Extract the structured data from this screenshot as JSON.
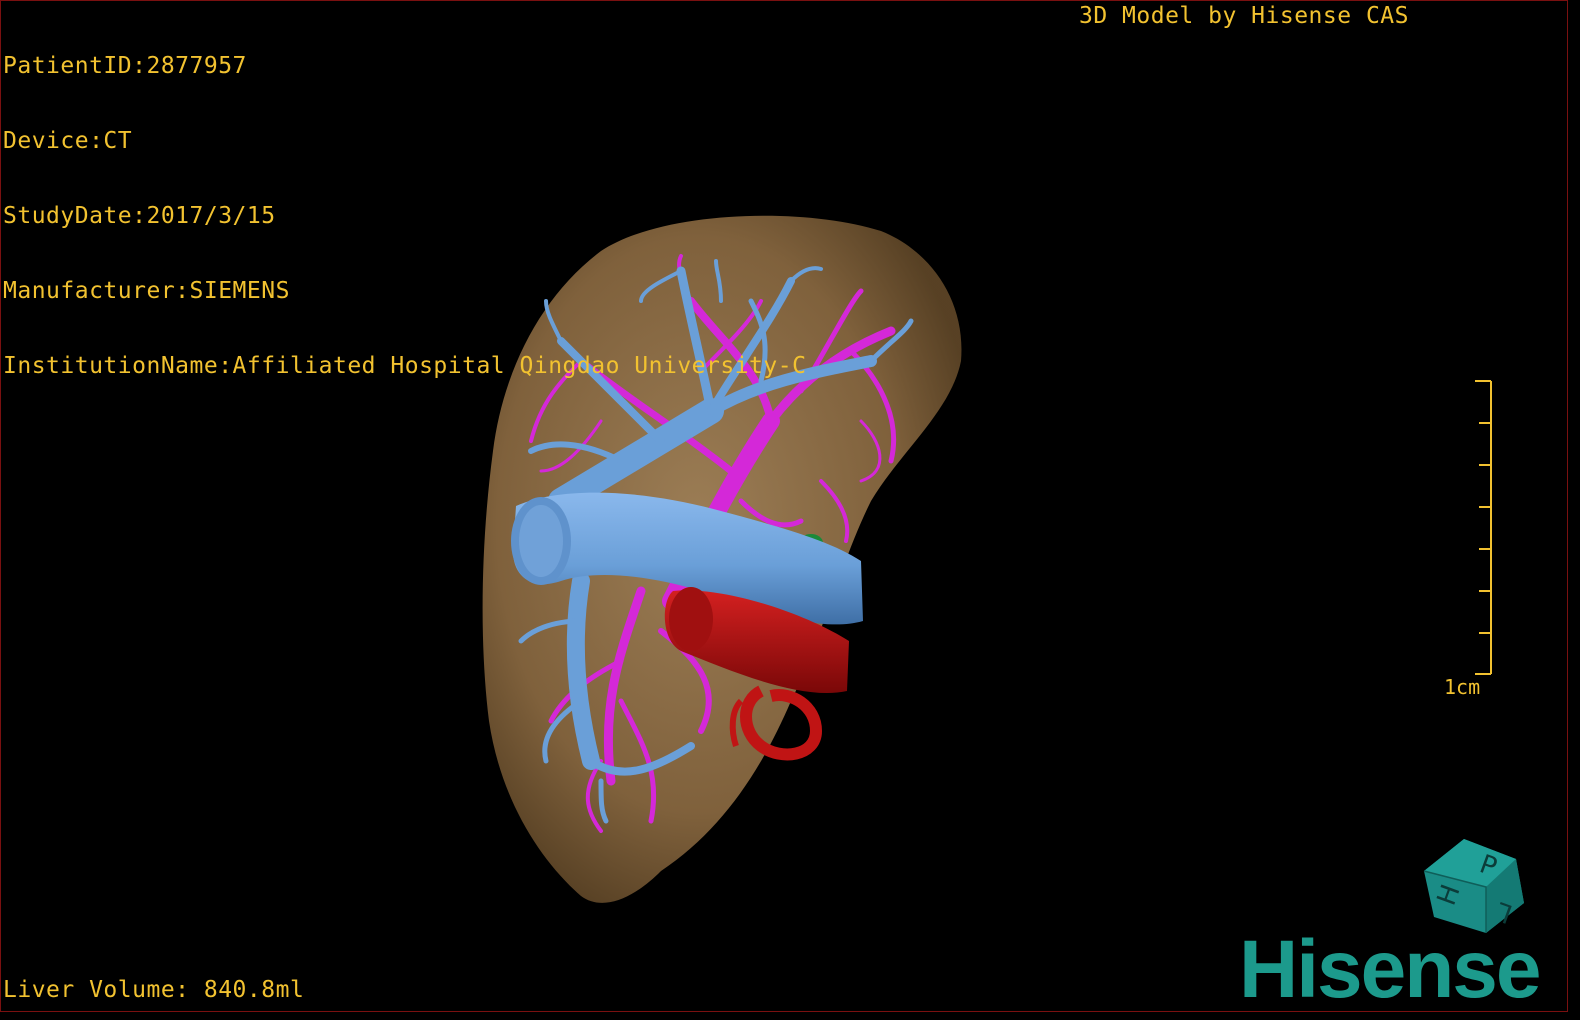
{
  "patient_info": {
    "patient_id": "PatientID:2877957",
    "device": "Device:CT",
    "study_date": "StudyDate:2017/3/15",
    "manufacturer": "Manufacturer:SIEMENS",
    "institution": "InstitutionName:Affiliated Hospital Qingdao University-C"
  },
  "model_credit": "3D Model by Hisense CAS",
  "liver_volume": "Liver Volume: 840.8ml",
  "scale_bar": {
    "label": "1cm",
    "ticks": 8
  },
  "orientation_cube": {
    "faces": [
      "P",
      "L",
      "H"
    ]
  },
  "brand_logo": "Hisense",
  "colors": {
    "overlay_text": "#f2c230",
    "liver": "#8a6a42",
    "hepatic_vein": "#6a9fd8",
    "portal_vein": "#d428d8",
    "artery": "#b01010",
    "brand": "#1c9a8c",
    "border": "#7a1010"
  }
}
